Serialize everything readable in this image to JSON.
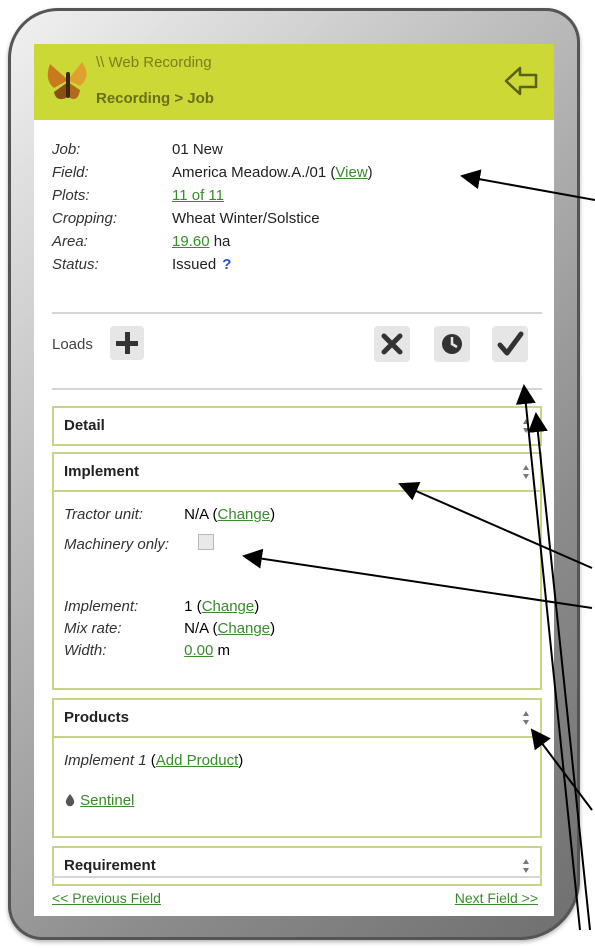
{
  "header": {
    "app_title": "\\\\ Web Recording",
    "breadcrumb": "Recording > Job",
    "back_icon": "back-arrow-icon",
    "accent_color": "#cbd836"
  },
  "job_info": {
    "job_label": "Job:",
    "job_value": "01 New",
    "field_label": "Field:",
    "field_value": "America Meadow.A./01",
    "field_view_open": "(",
    "field_view_link": "View",
    "field_view_close": ")",
    "plots_label": "Plots:",
    "plots_value": "11 of 11",
    "cropping_label": "Cropping:",
    "cropping_value": "Wheat Winter/Solstice",
    "area_label": "Area:",
    "area_value": "19.60",
    "area_unit": "ha",
    "status_label": "Status:",
    "status_value": "Issued",
    "status_help": "?"
  },
  "loads": {
    "label": "Loads",
    "add_icon": "plus-icon",
    "cancel_icon": "x-icon",
    "clock_icon": "clock-icon",
    "confirm_icon": "check-icon"
  },
  "sections": {
    "detail": "Detail",
    "implement": "Implement",
    "products": "Products",
    "requirement": "Requirement"
  },
  "implement_section": {
    "tractor_label": "Tractor unit:",
    "tractor_value": "N/A",
    "change_text": "Change",
    "machinery_label": "Machinery only:",
    "machinery_checked": false,
    "implement_label": "Implement:",
    "implement_value": "1",
    "mixrate_label": "Mix rate:",
    "mixrate_value": "N/A",
    "width_label": "Width:",
    "width_value": "0.00",
    "width_unit": "m"
  },
  "products_section": {
    "implement_label": "Implement 1",
    "add_product": "Add Product",
    "product_name": "Sentinel"
  },
  "footer": {
    "previous": "<< Previous Field",
    "next": "Next Field >>"
  }
}
